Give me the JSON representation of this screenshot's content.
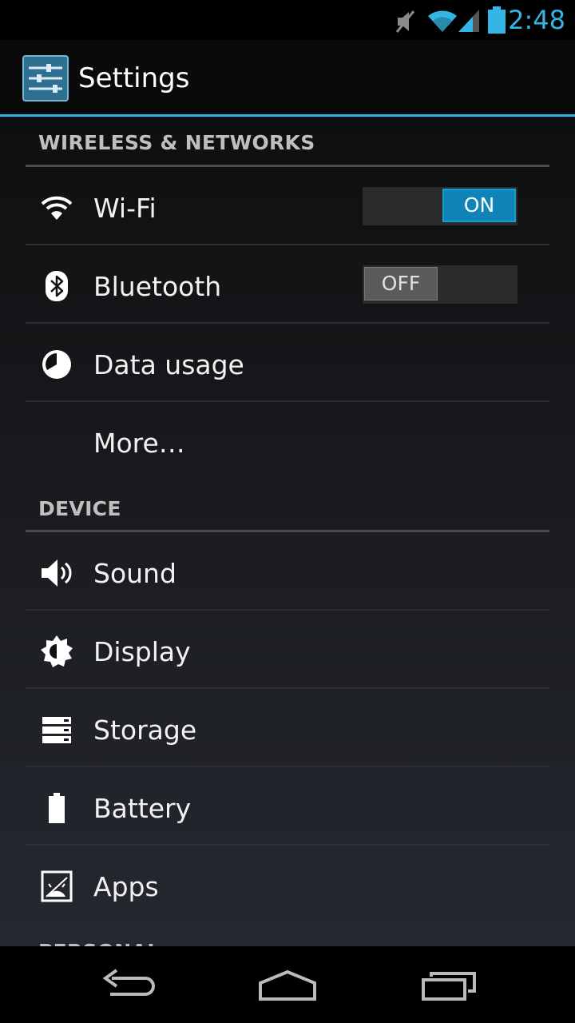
{
  "status_bar": {
    "time": "2:48",
    "icons": [
      "muted-icon",
      "wifi-signal-icon",
      "cell-signal-icon",
      "battery-icon"
    ],
    "accent_color": "#33b5e5"
  },
  "action_bar": {
    "title": "Settings",
    "icon": "settings-sliders-icon"
  },
  "sections": [
    {
      "header": "WIRELESS & NETWORKS"
    },
    {
      "header": "DEVICE"
    },
    {
      "header": "PERSONAL"
    }
  ],
  "items": {
    "wifi": {
      "label": "Wi-Fi",
      "icon": "wifi-icon",
      "toggle": "ON",
      "state": true
    },
    "bluetooth": {
      "label": "Bluetooth",
      "icon": "bluetooth-icon",
      "toggle": "OFF",
      "state": false
    },
    "data_usage": {
      "label": "Data usage",
      "icon": "data-usage-icon"
    },
    "more": {
      "label": "More…"
    },
    "sound": {
      "label": "Sound",
      "icon": "speaker-icon"
    },
    "display": {
      "label": "Display",
      "icon": "brightness-icon"
    },
    "storage": {
      "label": "Storage",
      "icon": "storage-icon"
    },
    "battery": {
      "label": "Battery",
      "icon": "battery-icon"
    },
    "apps": {
      "label": "Apps",
      "icon": "apps-icon"
    }
  },
  "nav_bar": {
    "buttons": [
      "back-icon",
      "home-icon",
      "recent-apps-icon"
    ]
  }
}
